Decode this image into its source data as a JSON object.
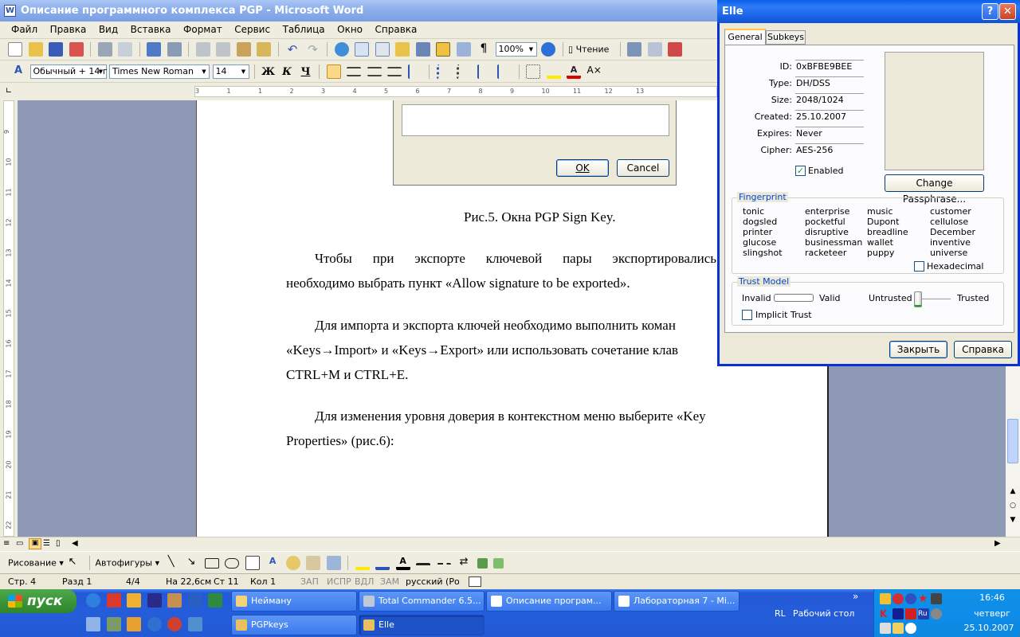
{
  "word": {
    "title": "Описание программного комплекса PGP - Microsoft Word",
    "menu": [
      "Файл",
      "Правка",
      "Вид",
      "Вставка",
      "Формат",
      "Сервис",
      "Таблица",
      "Окно",
      "Справка"
    ],
    "zoom": "100%",
    "reading_label": "Чтение",
    "style": "Обычный + 14 г",
    "font": "Times New Roman",
    "size": "14",
    "bold": "Ж",
    "italic": "К",
    "underline": "Ч",
    "ruler_numbers": [
      "3",
      "1",
      "1",
      "2",
      "3",
      "4",
      "5",
      "6",
      "7",
      "8",
      "9",
      "10",
      "11",
      "12",
      "13"
    ],
    "vruler_numbers": [
      "9",
      "10",
      "11",
      "12",
      "13",
      "14",
      "15",
      "16",
      "17",
      "18",
      "19",
      "20",
      "21",
      "22"
    ],
    "fragment": {
      "ok": "OK",
      "cancel": "Cancel"
    },
    "caption": "Рис.5. Окна PGP Sign Key.",
    "paragraphs": [
      {
        "line1": "Чтобы при экспорте ключевой пары экспортировались",
        "line2": "необходимо выбрать пункт «Allow signature to be exported»."
      },
      {
        "line1": "Для импорта и экспорта ключей необходимо выполнить коман",
        "line2": "«Keys→Import» и «Keys→Export» или использовать сочетание клав",
        "line3": "CTRL+M и CTRL+E."
      },
      {
        "line1": "Для изменения уровня доверия в контекстном меню выберите «Key",
        "line2": "Properties» (рис.6):"
      }
    ],
    "drawing": {
      "draw": "Рисование",
      "autoshapes": "Автофигуры"
    },
    "status": {
      "page": "Стр. 4",
      "section": "Разд 1",
      "pages": "4/4",
      "at": "На 22,6см",
      "line": "Ст 11",
      "col": "Кол 1",
      "rec": "ЗАП",
      "trk": "ИСПР",
      "ext": "ВДЛ",
      "ovr": "ЗАМ",
      "lang": "русский (Ро"
    }
  },
  "pgp": {
    "title": "Elle",
    "tabs": [
      "General",
      "Subkeys"
    ],
    "fields": [
      {
        "label": "ID:",
        "value": "0xBFBE9BEE"
      },
      {
        "label": "Type:",
        "value": "DH/DSS"
      },
      {
        "label": "Size:",
        "value": "2048/1024"
      },
      {
        "label": "Created:",
        "value": "25.10.2007"
      },
      {
        "label": "Expires:",
        "value": "Never"
      },
      {
        "label": "Cipher:",
        "value": "AES-256"
      }
    ],
    "enabled_label": "Enabled",
    "enabled": true,
    "change_passphrase": "Change Passphrase...",
    "fingerprint_title": "Fingerprint",
    "fingerprint_cols": [
      [
        "tonic",
        "dogsled",
        "printer",
        "glucose",
        "slingshot"
      ],
      [
        "enterprise",
        "pocketful",
        "disruptive",
        "businessman",
        "racketeer"
      ],
      [
        "music",
        "Dupont",
        "breadline",
        "wallet",
        "puppy"
      ],
      [
        "customer",
        "cellulose",
        "December",
        "inventive",
        "universe"
      ]
    ],
    "hexadecimal": "Hexadecimal",
    "trust_title": "Trust Model",
    "invalid": "Invalid",
    "valid": "Valid",
    "untrusted": "Untrusted",
    "trusted": "Trusted",
    "trust_level": 0,
    "implicit_trust": "Implicit Trust",
    "close": "Закрыть",
    "help": "Справка"
  },
  "taskbar": {
    "start": "пуск",
    "tasks_row1": [
      "Нейману",
      "Total Commander 6.5...",
      "Описание програм...",
      "Лабораторная 7 - Mi..."
    ],
    "tasks_row2": [
      "PGPkeys",
      "Elle"
    ],
    "desktop": "Рабочий стол",
    "lang": "RL",
    "time": "16:46",
    "day": "четверг",
    "date": "25.10.2007"
  }
}
